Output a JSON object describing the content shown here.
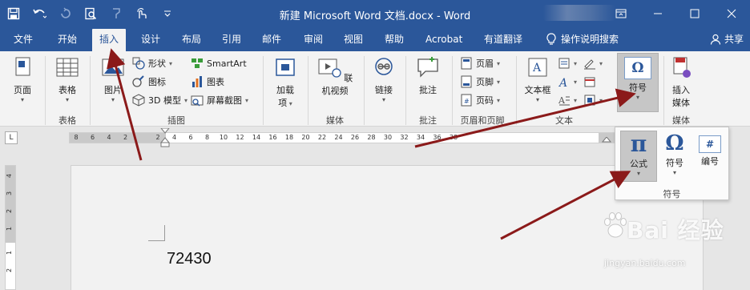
{
  "window": {
    "title": "新建 Microsoft Word 文档.docx  -  Word"
  },
  "tabs": {
    "file": "文件",
    "home": "开始",
    "insert": "插入",
    "design": "设计",
    "layout": "布局",
    "references": "引用",
    "mailings": "邮件",
    "review": "审阅",
    "view": "视图",
    "help": "帮助",
    "acrobat": "Acrobat",
    "youdao": "有道翻译",
    "tell_me": "操作说明搜索",
    "share": "共享"
  },
  "ribbon": {
    "pages": "页面",
    "table": "表格",
    "table_group": "表格",
    "pictures": "图片",
    "shapes": "形状",
    "icons": "图标",
    "models3d": "3D 模型",
    "smartart": "SmartArt",
    "chart": "图表",
    "screenshot": "屏幕截图",
    "illustrations_group": "插图",
    "addins_line1": "加载",
    "addins_line2": "项",
    "online_video": "联机视频",
    "media_group_1": "媒体",
    "links": "链接",
    "comment": "批注",
    "comment_group": "批注",
    "header": "页眉",
    "footer": "页脚",
    "page_number": "页码",
    "header_footer_group": "页眉和页脚",
    "textbox": "文本框",
    "text_group": "文本",
    "symbol": "符号",
    "insert_media_line1": "插入",
    "insert_media_line2": "媒体",
    "media_group_2": "媒体"
  },
  "ruler": {
    "tab_selector": "L",
    "ticks": [
      "8",
      "6",
      "4",
      "2",
      "2",
      "4",
      "6",
      "8",
      "10",
      "12",
      "14",
      "16",
      "18",
      "20",
      "22",
      "24",
      "26",
      "28",
      "30",
      "32",
      "34",
      "36",
      "38"
    ],
    "vticks": [
      "4",
      "3",
      "2",
      "1",
      "1",
      "2"
    ]
  },
  "document": {
    "text": "72430"
  },
  "symbol_dropdown": {
    "equation": "公式",
    "symbol": "符号",
    "number": "编号",
    "group_label": "符号",
    "pi_glyph": "π",
    "omega_glyph": "Ω",
    "hash_glyph": "#"
  },
  "watermark": {
    "brand": "Bai 经验",
    "url": "jingyan.baidu.com"
  },
  "colors": {
    "titlebar": "#2b579a",
    "ribbon": "#f3f3f3",
    "arrow": "#8b1a1a"
  }
}
